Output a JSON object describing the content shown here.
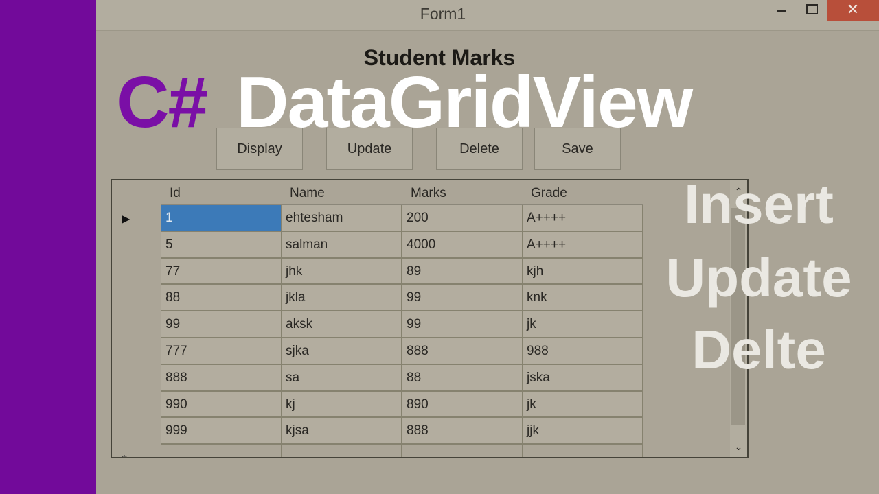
{
  "window": {
    "title": "Form1",
    "close_glyph": "✕"
  },
  "form": {
    "heading": "Student Marks"
  },
  "buttons": {
    "display": "Display",
    "update": "Update",
    "delete": "Delete",
    "save": "Save"
  },
  "grid": {
    "columns": [
      "Id",
      "Name",
      "Marks",
      "Grade"
    ],
    "rows": [
      [
        "1",
        "ehtesham",
        "200",
        "A++++"
      ],
      [
        "5",
        "salman",
        "4000",
        "A++++"
      ],
      [
        "77",
        "jhk",
        "89",
        "kjh"
      ],
      [
        "88",
        "jkla",
        "99",
        "knk"
      ],
      [
        "99",
        "aksk",
        "99",
        "jk"
      ],
      [
        "777",
        "sjka",
        "888",
        "988"
      ],
      [
        "888",
        "sa",
        "88",
        "jska"
      ],
      [
        "990",
        "kj",
        "890",
        "jk"
      ],
      [
        "999",
        "kjsa",
        "888",
        "jjk"
      ]
    ],
    "current_row_glyph": "▶",
    "new_row_glyph": "*",
    "scroll_up_glyph": "⌃",
    "scroll_down_glyph": "⌄"
  },
  "overlay": {
    "csharp": "C#",
    "title": "DataGridView",
    "line1": "Insert",
    "line2": "Update",
    "line3": "Delte"
  },
  "colors": {
    "purple": "#720a9a",
    "selection": "#3c7ab8",
    "close": "#b84f3a"
  }
}
